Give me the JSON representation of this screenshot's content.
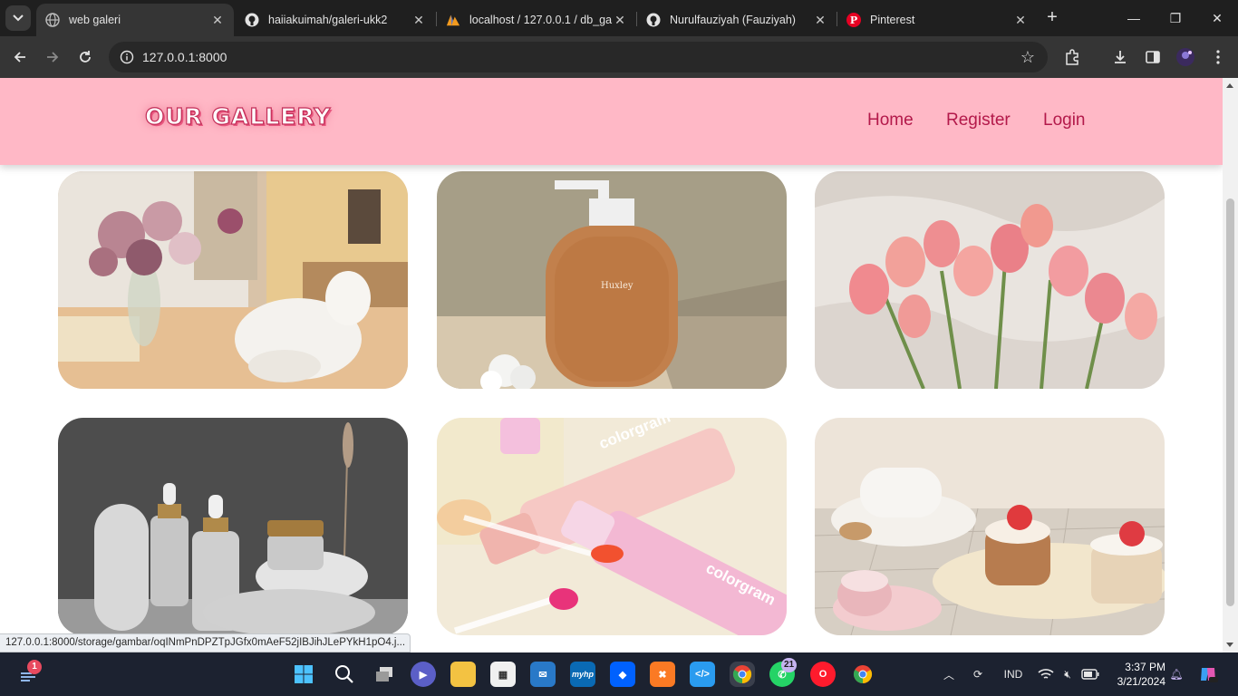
{
  "browser": {
    "tabs": [
      {
        "title": "web galeri",
        "active": true,
        "icon": "globe-icon"
      },
      {
        "title": "haiiakuimah/galeri-ukk2",
        "active": false,
        "icon": "github-icon"
      },
      {
        "title": "localhost / 127.0.0.1 / db_ga",
        "active": false,
        "icon": "phpmyadmin-icon"
      },
      {
        "title": "Nurulfauziyah (Fauziyah)",
        "active": false,
        "icon": "github-icon"
      },
      {
        "title": "Pinterest",
        "active": false,
        "icon": "pinterest-icon"
      }
    ],
    "url": "127.0.0.1:8000"
  },
  "site": {
    "brand": "OUR GALLERY",
    "nav": {
      "home": "Home",
      "register": "Register",
      "login": "Login"
    },
    "colors": {
      "navbar": "#ffb8c6",
      "nav_link": "#b3194a"
    }
  },
  "gallery": [
    {
      "subject": "white cat by window with peony bouquet"
    },
    {
      "subject": "Huxley amber pump bottle",
      "label": "Huxley"
    },
    {
      "subject": "pink tulip bouquet on white sheets"
    },
    {
      "subject": "frosted glass dropper bottles on stones"
    },
    {
      "subject": "pink colorgram lip tint tubes",
      "label": "colorgram"
    },
    {
      "subject": "teacup with strawberry cakes"
    }
  ],
  "status_link": "127.0.0.1:8000/storage/gambar/oqINmPnDPZTpJGfx0mAeF52jIBJihJLePYkH1pO4.j...",
  "taskbar": {
    "notification_badge": "1",
    "whatsapp_badge": "21",
    "language": "IND",
    "time": "3:37 PM",
    "date": "3/21/2024"
  }
}
